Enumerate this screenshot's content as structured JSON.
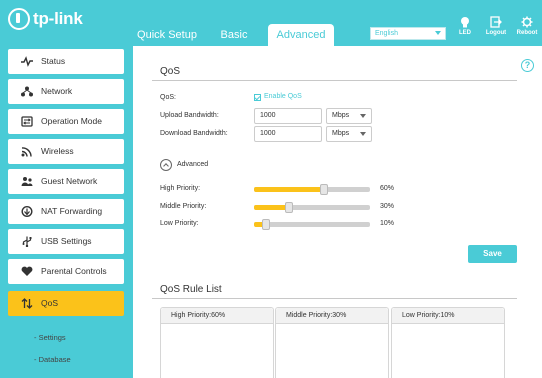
{
  "brand": {
    "logo_text": "tp-link"
  },
  "header": {
    "tabs": [
      {
        "label": "Quick Setup"
      },
      {
        "label": "Basic"
      },
      {
        "label": "Advanced",
        "active": true
      }
    ],
    "language": {
      "selected": "English"
    },
    "buttons": {
      "led": "LED",
      "logout": "Logout",
      "reboot": "Reboot"
    }
  },
  "sidebar": {
    "items": [
      {
        "label": "Status",
        "icon": "status-icon"
      },
      {
        "label": "Network",
        "icon": "network-icon"
      },
      {
        "label": "Operation Mode",
        "icon": "operation-mode-icon"
      },
      {
        "label": "Wireless",
        "icon": "wireless-icon"
      },
      {
        "label": "Guest Network",
        "icon": "guest-network-icon"
      },
      {
        "label": "NAT Forwarding",
        "icon": "nat-forwarding-icon"
      },
      {
        "label": "USB Settings",
        "icon": "usb-icon"
      },
      {
        "label": "Parental Controls",
        "icon": "parental-controls-icon"
      },
      {
        "label": "QoS",
        "icon": "qos-icon",
        "active": true
      }
    ],
    "sub_items": [
      {
        "label": "- Settings"
      },
      {
        "label": "- Database"
      }
    ]
  },
  "qos": {
    "title": "QoS",
    "qos_label": "QoS:",
    "enable_label": "Enable QoS",
    "enabled": true,
    "upload": {
      "label": "Upload Bandwidth:",
      "value": "1000",
      "unit": "Mbps"
    },
    "download": {
      "label": "Download Bandwidth:",
      "value": "1000",
      "unit": "Mbps"
    },
    "advanced_label": "Advanced",
    "priorities": [
      {
        "label": "High Priority:",
        "percent": 60,
        "percent_text": "60%"
      },
      {
        "label": "Middle Priority:",
        "percent": 30,
        "percent_text": "30%"
      },
      {
        "label": "Low Priority:",
        "percent": 10,
        "percent_text": "10%"
      }
    ],
    "save_label": "Save"
  },
  "rule_list": {
    "title": "QoS Rule List",
    "panels": [
      {
        "label": "High Priority:60%"
      },
      {
        "label": "Middle Priority:30%"
      },
      {
        "label": "Low Priority:10%"
      }
    ]
  },
  "colors": {
    "accent": "#4acbd6",
    "active_nav": "#fbc21a"
  }
}
